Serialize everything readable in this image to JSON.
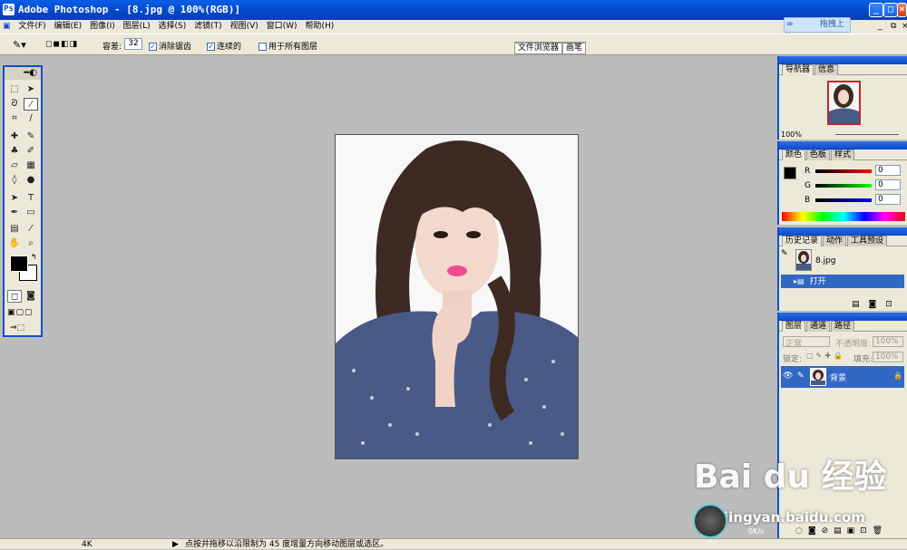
{
  "titlebar": {
    "title": "Adobe Photoshop - [8.jpg @ 100%(RGB)]",
    "upload_button": "拖拽上传"
  },
  "menu": [
    "文件(F)",
    "编辑(E)",
    "图像(I)",
    "图层(L)",
    "选择(S)",
    "滤镜(T)",
    "视图(V)",
    "窗口(W)",
    "帮助(H)"
  ],
  "options": {
    "tolerance_label": "容差:",
    "tolerance_value": "32",
    "antialias": "消除锯齿",
    "contiguous": "连续的",
    "all_layers": "用于所有图层",
    "antialias_checked": true,
    "contiguous_checked": true,
    "all_layers_checked": false
  },
  "palette_well": {
    "tab1": "文件浏览器",
    "tab2": "画笔"
  },
  "navigator": {
    "tab1": "导航器",
    "tab2": "信息",
    "zoom": "100%"
  },
  "color": {
    "tab1": "颜色",
    "tab2": "色板",
    "tab3": "样式",
    "r_label": "R",
    "g_label": "G",
    "b_label": "B",
    "r": "0",
    "g": "0",
    "b": "0"
  },
  "history": {
    "tab1": "历史记录",
    "tab2": "动作",
    "tab3": "工具预设",
    "snapshot": "8.jpg",
    "step": "打开"
  },
  "layers": {
    "tab1": "图层",
    "tab2": "通道",
    "tab3": "路径",
    "mode": "正常",
    "opacity_label": "不透明度:",
    "opacity": "100%",
    "lock_label": "锁定:",
    "fill_label": "填充:",
    "fill": "100%",
    "layer_name": "背景"
  },
  "status": {
    "size": "4K",
    "hint": "点按并拖移以沿限制为 45 度增量方向移动图层或选区。"
  },
  "watermark": {
    "brand": "Bai du 经验",
    "url": "jingyan.baidu.com",
    "speed": "0K/s"
  }
}
